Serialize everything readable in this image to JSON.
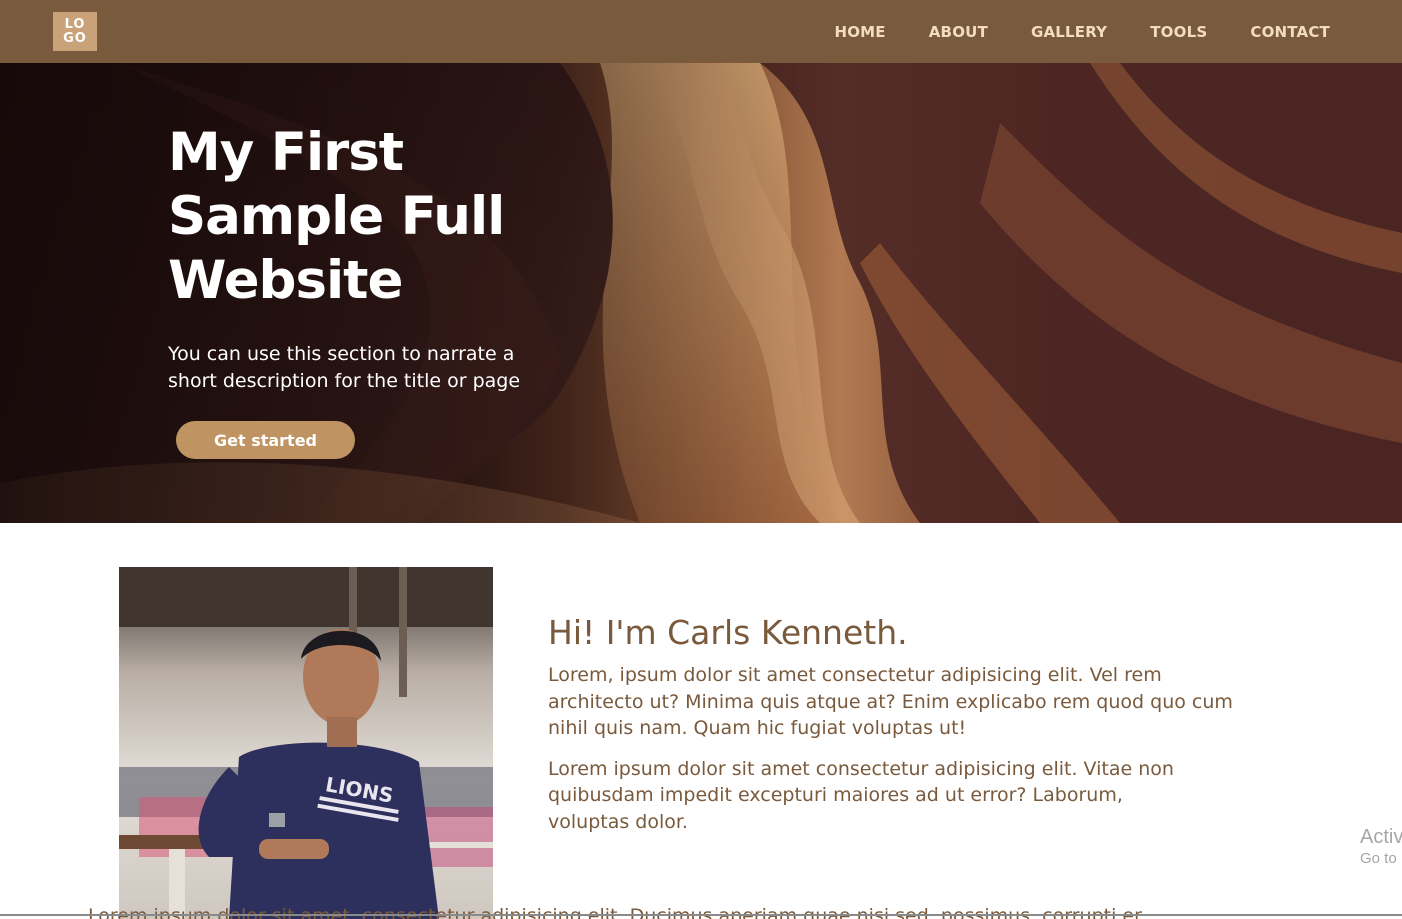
{
  "navbar": {
    "logo_line1": "LO",
    "logo_line2": "GO",
    "links": [
      "HOME",
      "ABOUT",
      "GALLERY",
      "TOOLS",
      "CONTACT"
    ]
  },
  "hero": {
    "title": "My First Sample Full Website",
    "description": "You can use this section to narrate a short description for the title or page",
    "button_label": "Get started"
  },
  "about": {
    "heading": "Hi! I'm Carls Kenneth.",
    "paragraph1": "Lorem, ipsum dolor sit amet consectetur adipisicing elit. Vel rem architecto ut? Minima quis atque at? Enim explicabo rem quod quo cum nihil quis nam. Quam hic fugiat voluptas ut!",
    "paragraph2": "Lorem ipsum dolor sit amet consectetur adipisicing elit. Vitae non quibusdam impedit excepturi maiores ad ut error? Laborum, voluptas dolor.",
    "photo_shirt_text": "LIONS",
    "cut_off_text": "Lorem ipsum dolor sit amet, consectetur adipisicing elit. Ducimus aperiam quae nisi sed, possimus, corrupti er"
  },
  "watermark": {
    "line1": "Activ",
    "line2": "Go to"
  },
  "colors": {
    "nav_bg": "#7a5a3c",
    "nav_text": "#f3dcc0",
    "accent": "#c09462",
    "heading_brown": "#7a5a3c"
  }
}
